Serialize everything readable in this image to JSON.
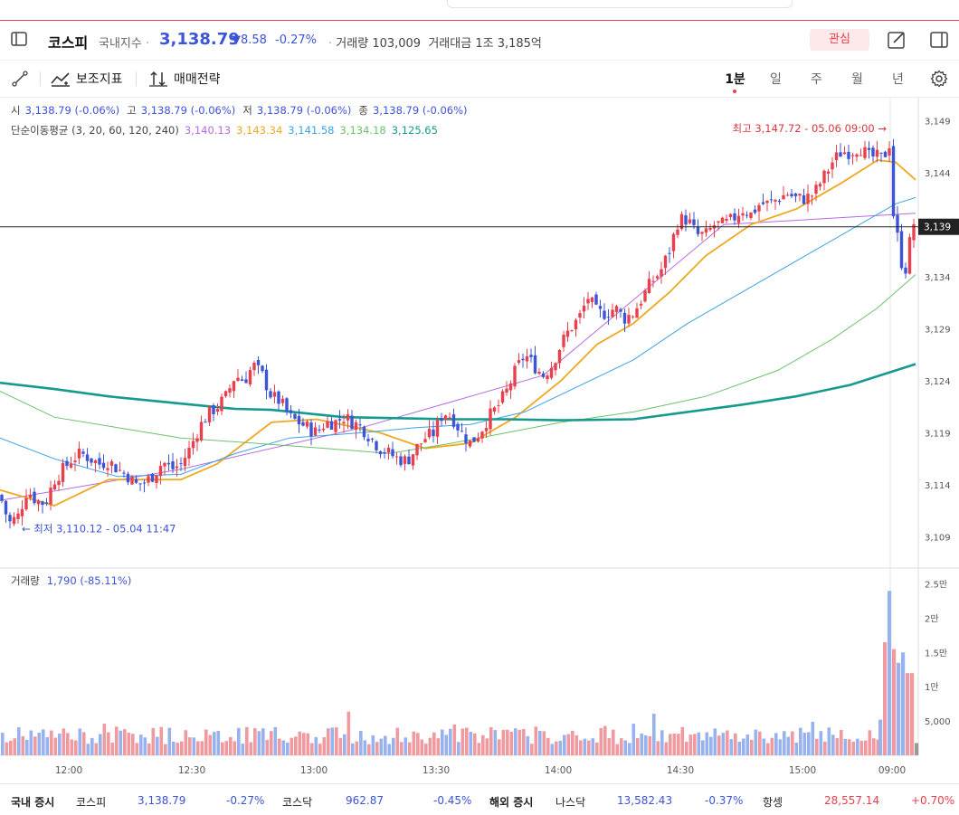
{
  "header": {
    "name": "코스피",
    "category": "국내지수",
    "price": "3,138.79",
    "change": "▼8.58",
    "change_pct": "-0.27%",
    "volume_label": "거래량",
    "volume_value": "103,009",
    "amount_label": "거래대금",
    "amount_value": "1조 3,185억",
    "fav_label": "관심"
  },
  "toolbar": {
    "indicators_label": "보조지표",
    "strategy_label": "매매전략",
    "periods": [
      "1분",
      "일",
      "주",
      "월",
      "년"
    ],
    "active_period": "1분"
  },
  "legend": {
    "ohlc": [
      {
        "label": "시",
        "value": "3,138.79 (-0.06%)"
      },
      {
        "label": "고",
        "value": "3,138.79 (-0.06%)"
      },
      {
        "label": "저",
        "value": "3,138.79 (-0.06%)"
      },
      {
        "label": "종",
        "value": "3,138.79 (-0.06%)"
      }
    ],
    "ma_title": "단순이동평균 (3, 20, 60, 120, 240)",
    "ma_values": [
      "3,140.13",
      "3,143.34",
      "3,141.58",
      "3,134.18",
      "3,125.65"
    ],
    "ma_colors": [
      "#b66be0",
      "#f0a820",
      "#3aa3e6",
      "#6cc16c",
      "#159a8e"
    ],
    "volume_title": "거래량",
    "volume_value": "1,790 (-85.11%)"
  },
  "chart_data": {
    "type": "candlestick",
    "y_ticks": [
      "3,149",
      "3,144",
      "3,139",
      "3,134",
      "3,129",
      "3,124",
      "3,119",
      "3,114",
      "3,109"
    ],
    "y_tick_values": [
      3149,
      3144,
      3139,
      3134,
      3129,
      3124,
      3119,
      3114,
      3109
    ],
    "ylim": [
      3106,
      3150.5
    ],
    "current_price_label": "3,139",
    "current_price": 3138.79,
    "high_annotation": "최고 3,147.72 - 05.06 09:00 →",
    "low_annotation": "← 최저 3,110.12 - 05.04 11:47",
    "x_tick_labels": [
      "12:00",
      "12:30",
      "13:00",
      "13:30",
      "14:00",
      "14:30",
      "15:00",
      "09:00"
    ],
    "volume_ticks": [
      "2.5만",
      "2만",
      "1.5만",
      "1만",
      "5,000"
    ],
    "volume_tick_values": [
      25000,
      20000,
      15000,
      10000,
      5000
    ],
    "volume_max": 26000,
    "close_path": [
      [
        0,
        3113.0
      ],
      [
        10,
        3110.3
      ],
      [
        20,
        3111.0
      ],
      [
        30,
        3113.5
      ],
      [
        40,
        3112.5
      ],
      [
        50,
        3112.2
      ],
      [
        60,
        3114.5
      ],
      [
        70,
        3115.5
      ],
      [
        80,
        3116.5
      ],
      [
        90,
        3117.0
      ],
      [
        100,
        3116.5
      ],
      [
        110,
        3116.0
      ],
      [
        120,
        3116.3
      ],
      [
        130,
        3115.5
      ],
      [
        140,
        3115.0
      ],
      [
        150,
        3114.0
      ],
      [
        160,
        3114.2
      ],
      [
        170,
        3115.0
      ],
      [
        180,
        3116.2
      ],
      [
        190,
        3115.5
      ],
      [
        200,
        3116.0
      ],
      [
        210,
        3117.5
      ],
      [
        220,
        3119.5
      ],
      [
        230,
        3120.8
      ],
      [
        240,
        3121.5
      ],
      [
        250,
        3122.5
      ],
      [
        260,
        3124.5
      ],
      [
        270,
        3124.0
      ],
      [
        280,
        3125.5
      ],
      [
        290,
        3124.5
      ],
      [
        300,
        3122.5
      ],
      [
        310,
        3122.0
      ],
      [
        320,
        3120.5
      ],
      [
        330,
        3120.0
      ],
      [
        340,
        3119.5
      ],
      [
        350,
        3119.0
      ],
      [
        360,
        3120.0
      ],
      [
        370,
        3120.0
      ],
      [
        380,
        3120.5
      ],
      [
        390,
        3120.0
      ],
      [
        400,
        3119.5
      ],
      [
        410,
        3118.5
      ],
      [
        420,
        3117.5
      ],
      [
        430,
        3117.0
      ],
      [
        440,
        3116.5
      ],
      [
        450,
        3116.3
      ],
      [
        460,
        3117.5
      ],
      [
        470,
        3118.5
      ],
      [
        480,
        3119.0
      ],
      [
        490,
        3121.0
      ],
      [
        500,
        3120.5
      ],
      [
        510,
        3119.0
      ],
      [
        520,
        3118.0
      ],
      [
        530,
        3119.0
      ],
      [
        540,
        3120.5
      ],
      [
        550,
        3121.5
      ],
      [
        560,
        3123.0
      ],
      [
        570,
        3125.0
      ],
      [
        580,
        3126.5
      ],
      [
        590,
        3125.5
      ],
      [
        600,
        3124.5
      ],
      [
        610,
        3125.5
      ],
      [
        620,
        3127.5
      ],
      [
        630,
        3129.0
      ],
      [
        640,
        3130.0
      ],
      [
        650,
        3132.0
      ],
      [
        660,
        3130.5
      ],
      [
        670,
        3130.5
      ],
      [
        680,
        3131.0
      ],
      [
        690,
        3130.0
      ],
      [
        700,
        3130.5
      ],
      [
        710,
        3132.0
      ],
      [
        720,
        3133.5
      ],
      [
        730,
        3134.5
      ],
      [
        740,
        3136.5
      ],
      [
        750,
        3139.5
      ],
      [
        760,
        3139.5
      ],
      [
        770,
        3138.0
      ],
      [
        780,
        3138.0
      ],
      [
        790,
        3139.0
      ],
      [
        800,
        3139.0
      ],
      [
        810,
        3139.5
      ],
      [
        820,
        3140.5
      ],
      [
        830,
        3140.0
      ],
      [
        840,
        3141.0
      ],
      [
        850,
        3141.0
      ],
      [
        860,
        3141.5
      ],
      [
        870,
        3142.0
      ],
      [
        880,
        3141.5
      ],
      [
        890,
        3141.5
      ],
      [
        900,
        3142.0
      ],
      [
        910,
        3143.5
      ],
      [
        920,
        3145.0
      ],
      [
        930,
        3146.0
      ],
      [
        940,
        3146.0
      ],
      [
        950,
        3146.5
      ],
      [
        960,
        3145.5
      ],
      [
        970,
        3145.5
      ],
      [
        976,
        3145.3
      ],
      [
        984,
        3147.0
      ],
      [
        988,
        3139.0
      ],
      [
        993,
        3137.5
      ],
      [
        998,
        3134.5
      ],
      [
        1003,
        3135.0
      ],
      [
        1008,
        3139.5
      ],
      [
        1012,
        3138.8
      ]
    ],
    "moving_averages": [
      {
        "name": "3",
        "points": [
          [
            0,
            3112.5
          ],
          [
            200,
            3115.5
          ],
          [
            400,
            3119.5
          ],
          [
            600,
            3124.5
          ],
          [
            800,
            3139.0
          ],
          [
            1012,
            3140.1
          ]
        ]
      },
      {
        "name": "20",
        "points": [
          [
            0,
            3113.5
          ],
          [
            60,
            3112.0
          ],
          [
            120,
            3114.5
          ],
          [
            200,
            3114.5
          ],
          [
            240,
            3116.0
          ],
          [
            300,
            3120.0
          ],
          [
            350,
            3120.3
          ],
          [
            420,
            3119.0
          ],
          [
            470,
            3117.5
          ],
          [
            520,
            3118.0
          ],
          [
            570,
            3120.5
          ],
          [
            620,
            3124.0
          ],
          [
            660,
            3127.5
          ],
          [
            700,
            3129.5
          ],
          [
            740,
            3132.5
          ],
          [
            780,
            3136.0
          ],
          [
            830,
            3139.0
          ],
          [
            880,
            3140.5
          ],
          [
            930,
            3143.0
          ],
          [
            970,
            3145.2
          ],
          [
            990,
            3145.0
          ],
          [
            1012,
            3143.3
          ]
        ]
      },
      {
        "name": "60",
        "points": [
          [
            0,
            3118.5
          ],
          [
            60,
            3116.5
          ],
          [
            130,
            3114.8
          ],
          [
            200,
            3115.0
          ],
          [
            260,
            3117.0
          ],
          [
            320,
            3118.5
          ],
          [
            400,
            3119.0
          ],
          [
            460,
            3119.5
          ],
          [
            520,
            3119.8
          ],
          [
            580,
            3121.0
          ],
          [
            640,
            3123.5
          ],
          [
            700,
            3126.0
          ],
          [
            760,
            3129.5
          ],
          [
            820,
            3132.5
          ],
          [
            880,
            3135.5
          ],
          [
            940,
            3138.5
          ],
          [
            990,
            3141.0
          ],
          [
            1012,
            3141.6
          ]
        ]
      },
      {
        "name": "120",
        "points": [
          [
            0,
            3123.0
          ],
          [
            60,
            3120.5
          ],
          [
            130,
            3119.5
          ],
          [
            200,
            3118.5
          ],
          [
            280,
            3118.0
          ],
          [
            360,
            3117.5
          ],
          [
            430,
            3117.0
          ],
          [
            500,
            3118.0
          ],
          [
            560,
            3119.0
          ],
          [
            620,
            3120.0
          ],
          [
            700,
            3121.0
          ],
          [
            780,
            3122.5
          ],
          [
            860,
            3125.0
          ],
          [
            920,
            3128.0
          ],
          [
            970,
            3131.0
          ],
          [
            1012,
            3134.2
          ]
        ]
      },
      {
        "name": "240",
        "points": [
          [
            0,
            3123.8
          ],
          [
            60,
            3123.2
          ],
          [
            120,
            3122.5
          ],
          [
            200,
            3121.8
          ],
          [
            260,
            3121.3
          ],
          [
            300,
            3121.2
          ],
          [
            380,
            3120.5
          ],
          [
            440,
            3120.4
          ],
          [
            500,
            3120.3
          ],
          [
            560,
            3120.3
          ],
          [
            620,
            3120.2
          ],
          [
            700,
            3120.3
          ],
          [
            760,
            3121.0
          ],
          [
            820,
            3121.7
          ],
          [
            880,
            3122.5
          ],
          [
            940,
            3123.6
          ],
          [
            1012,
            3125.6
          ]
        ]
      }
    ]
  },
  "footer": {
    "domestic_label": "국내 증시",
    "kospi_name": "코스피",
    "kospi_value": "3,138.79",
    "kospi_pct": "-0.27%",
    "kosdaq_name": "코스닥",
    "kosdaq_value": "962.87",
    "kosdaq_pct": "-0.45%",
    "overseas_label": "해외 증시",
    "nasdaq_name": "나스닥",
    "nasdaq_value": "13,582.43",
    "nasdaq_pct": "-0.37%",
    "hangseng_name": "항셍",
    "hangseng_value": "28,557.14",
    "hangseng_pct": "+0.70%"
  }
}
